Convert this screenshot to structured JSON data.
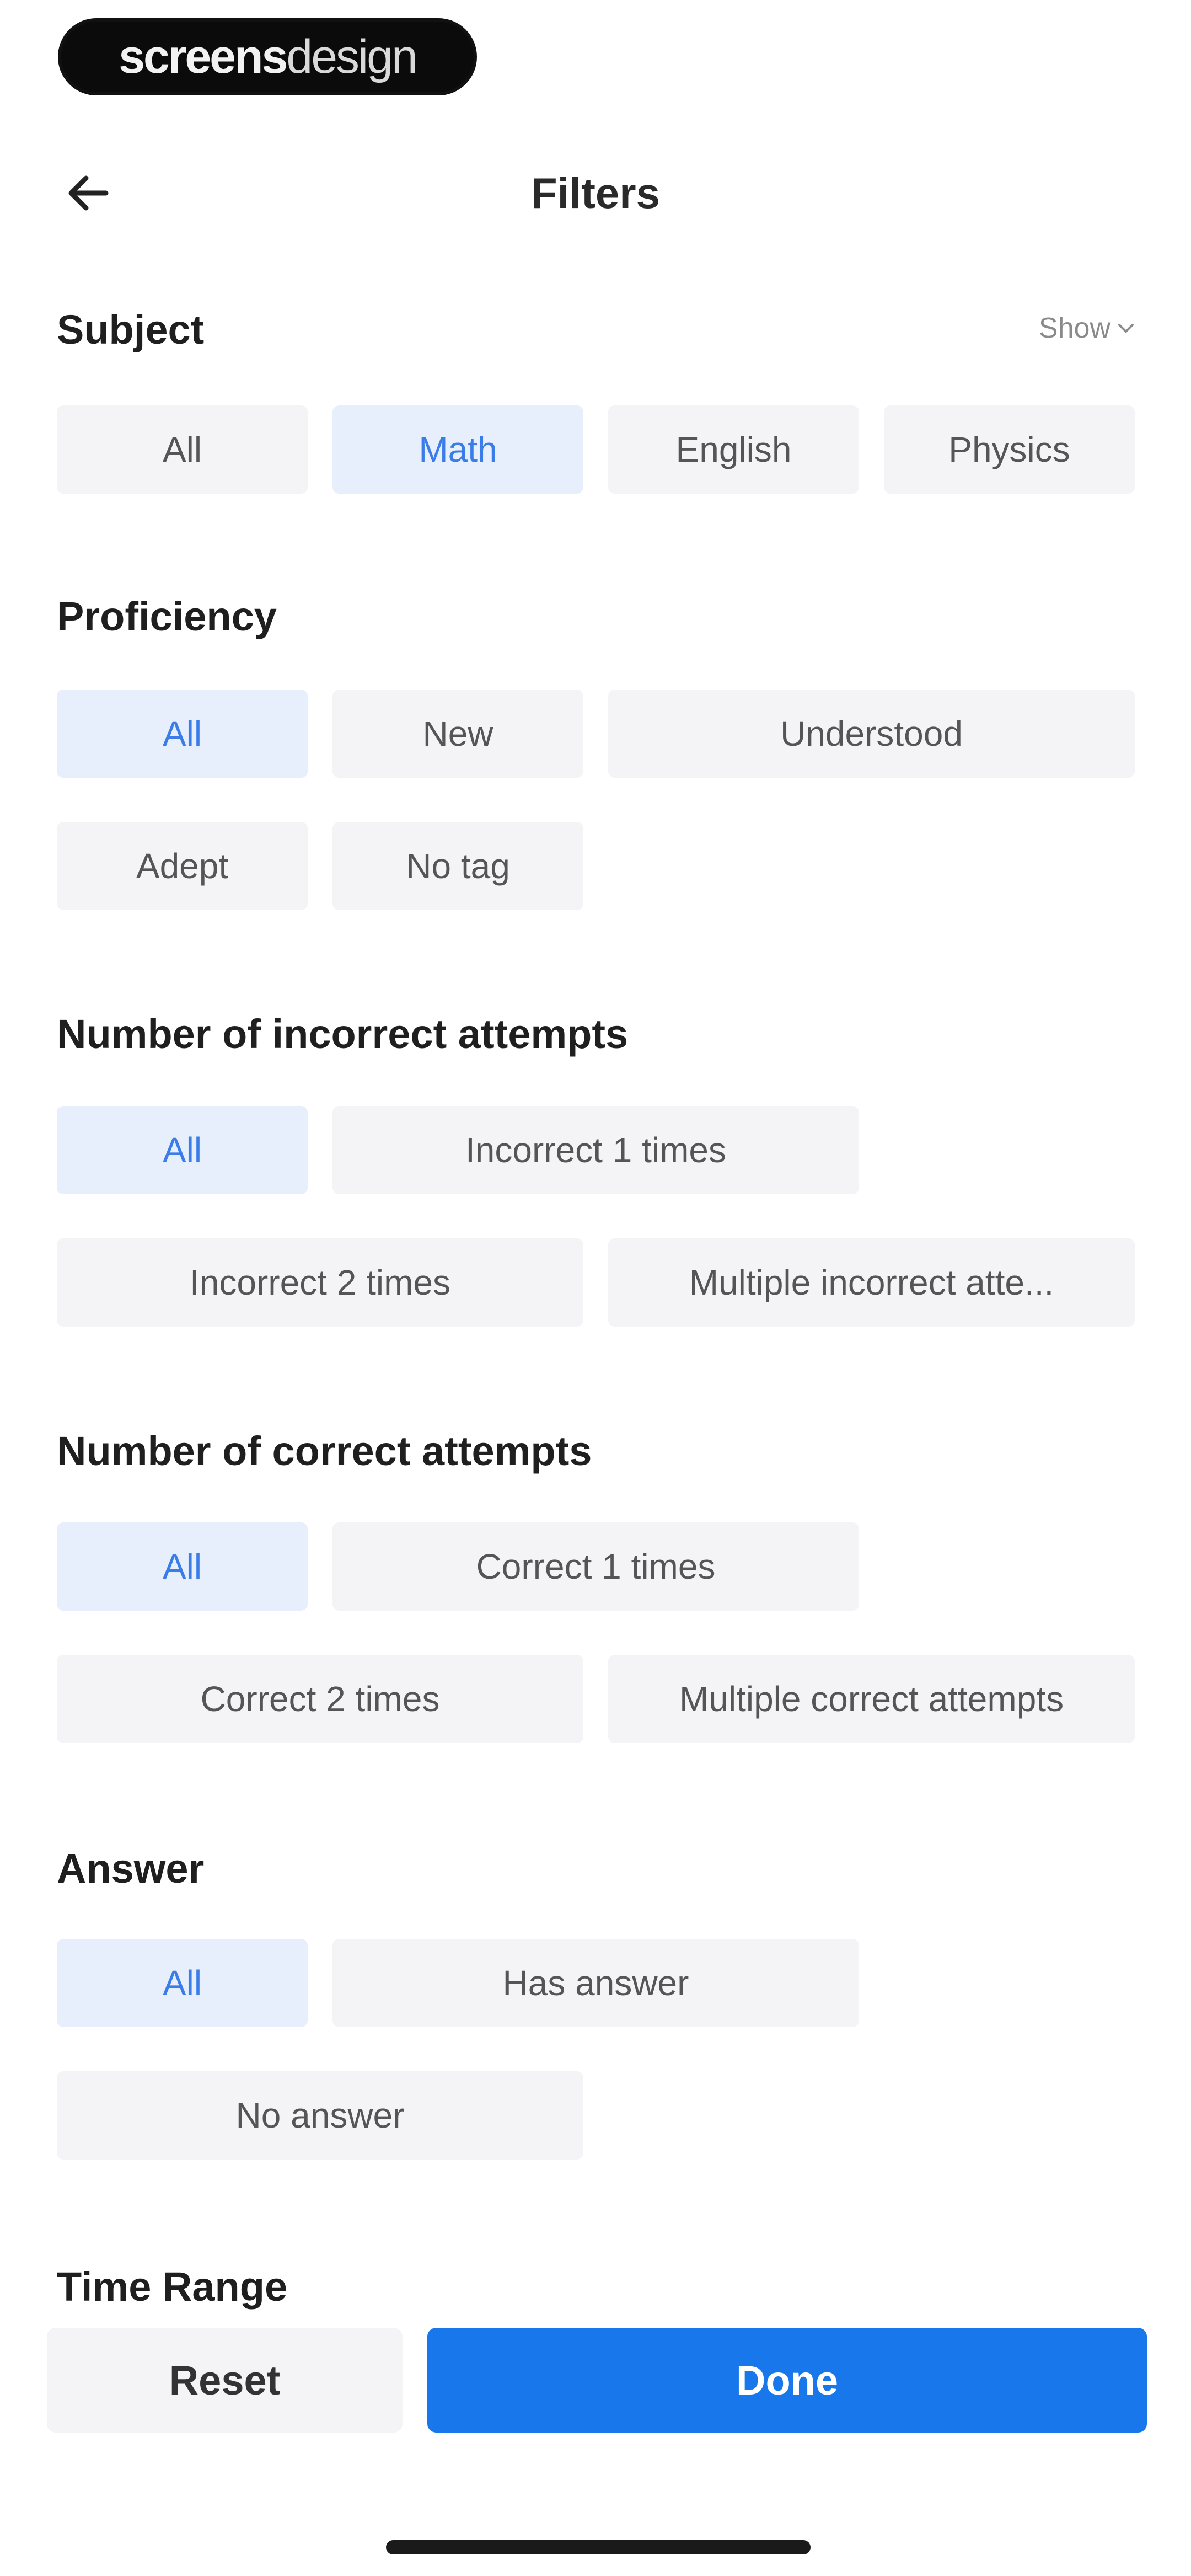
{
  "watermark": {
    "part1": "screens",
    "part2": "design"
  },
  "header": {
    "title": "Filters"
  },
  "icons": {
    "back": "arrow-left-icon",
    "show": "chevron-down-icon"
  },
  "colors": {
    "accent": "#1877ea",
    "chip_active_bg": "#e7effd",
    "chip_active_text": "#3a7de8",
    "chip_bg": "#f4f4f6"
  },
  "subject": {
    "title": "Subject",
    "show_label": "Show",
    "options": [
      "All",
      "Math",
      "English",
      "Physics"
    ],
    "selected": "Math"
  },
  "proficiency": {
    "title": "Proficiency",
    "options": [
      "All",
      "New",
      "Understood",
      "Adept",
      "No tag"
    ],
    "selected": "All"
  },
  "incorrect": {
    "title": "Number of incorrect attempts",
    "options": [
      "All",
      "Incorrect 1 times",
      "Incorrect 2 times",
      "Multiple incorrect atte..."
    ],
    "selected": "All"
  },
  "correct": {
    "title": "Number of correct attempts",
    "options": [
      "All",
      "Correct 1 times",
      "Correct 2 times",
      "Multiple correct attempts"
    ],
    "selected": "All"
  },
  "answer": {
    "title": "Answer",
    "options": [
      "All",
      "Has answer",
      "No answer"
    ],
    "selected": "All"
  },
  "time_range": {
    "title": "Time Range"
  },
  "footer": {
    "reset_label": "Reset",
    "done_label": "Done"
  }
}
